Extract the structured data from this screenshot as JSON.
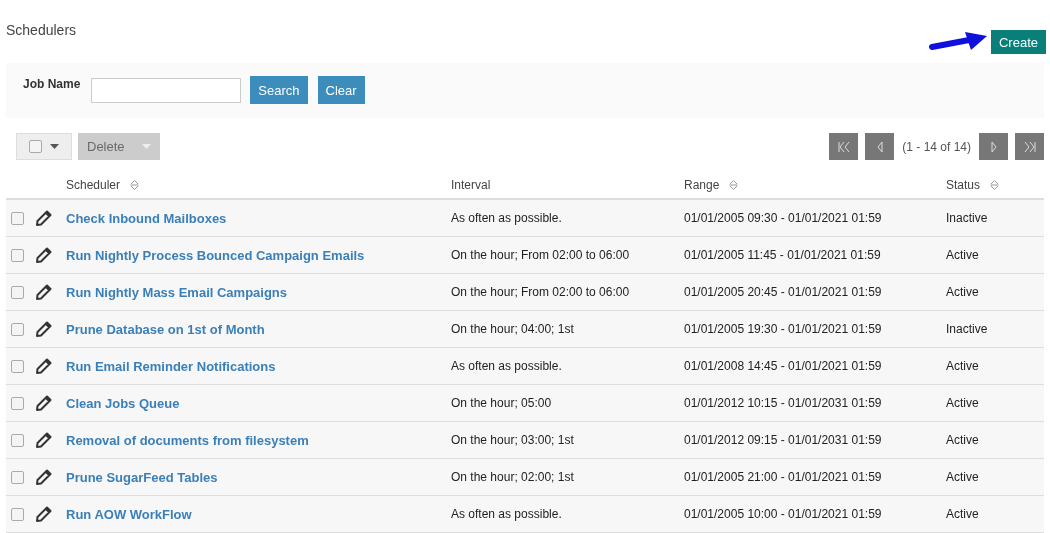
{
  "page_title": "Schedulers",
  "create_button": "Create",
  "search": {
    "label": "Job Name",
    "search_button": "Search",
    "clear_button": "Clear"
  },
  "toolbar": {
    "select_all_checked": false,
    "delete_button": "Delete",
    "delete_disabled": true,
    "pagination": "(1 - 14 of 14)"
  },
  "table": {
    "columns": [
      {
        "label": "Scheduler",
        "sortable": true
      },
      {
        "label": "Interval",
        "sortable": false
      },
      {
        "label": "Range",
        "sortable": true
      },
      {
        "label": "Status",
        "sortable": true
      }
    ],
    "rows": [
      {
        "checked": false,
        "name": "Check Inbound Mailboxes",
        "interval": "As often as possible.",
        "range": "01/01/2005 09:30 - 01/01/2021 01:59",
        "status": "Inactive"
      },
      {
        "checked": false,
        "name": "Run Nightly Process Bounced Campaign Emails",
        "interval": "On the hour; From 02:00 to 06:00",
        "range": "01/01/2005 11:45 - 01/01/2021 01:59",
        "status": "Active"
      },
      {
        "checked": false,
        "name": "Run Nightly Mass Email Campaigns",
        "interval": "On the hour; From 02:00 to 06:00",
        "range": "01/01/2005 20:45 - 01/01/2021 01:59",
        "status": "Active"
      },
      {
        "checked": false,
        "name": "Prune Database on 1st of Month",
        "interval": "On the hour; 04:00; 1st",
        "range": "01/01/2005 19:30 - 01/01/2021 01:59",
        "status": "Inactive"
      },
      {
        "checked": false,
        "name": "Run Email Reminder Notifications",
        "interval": "As often as possible.",
        "range": "01/01/2008 14:45 - 01/01/2021 01:59",
        "status": "Active"
      },
      {
        "checked": false,
        "name": "Clean Jobs Queue",
        "interval": "On the hour; 05:00",
        "range": "01/01/2012 10:15 - 01/01/2031 01:59",
        "status": "Active"
      },
      {
        "checked": false,
        "name": "Removal of documents from filesystem",
        "interval": "On the hour; 03:00; 1st",
        "range": "01/01/2012 09:15 - 01/01/2031 01:59",
        "status": "Active"
      },
      {
        "checked": false,
        "name": "Prune SugarFeed Tables",
        "interval": "On the hour; 02:00; 1st",
        "range": "01/01/2005 21:00 - 01/01/2021 01:59",
        "status": "Active"
      },
      {
        "checked": false,
        "name": "Run AOW WorkFlow",
        "interval": "As often as possible.",
        "range": "01/01/2005 10:00 - 01/01/2021 01:59",
        "status": "Active"
      }
    ]
  }
}
